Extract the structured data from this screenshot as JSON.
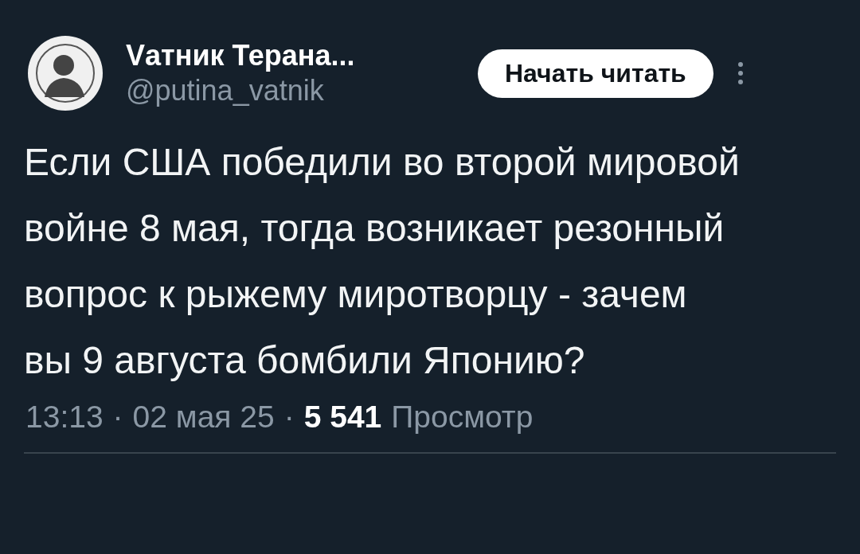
{
  "author": {
    "name": "Vатник Терана...",
    "handle": "@putina_vatnik"
  },
  "follow_button": {
    "label": "Начать читать"
  },
  "tweet": {
    "text": "Если США победили во второй мировой войне 8 мая, тогда возникает резонный  вопрос к рыжему миротворцу - зачем вы 9 августа бомбили Японию?"
  },
  "meta": {
    "time": "13:13",
    "separator_1": "·",
    "date": "02 мая 25",
    "separator_2": "·",
    "views": "5 541",
    "views_label": "Просмотр"
  }
}
